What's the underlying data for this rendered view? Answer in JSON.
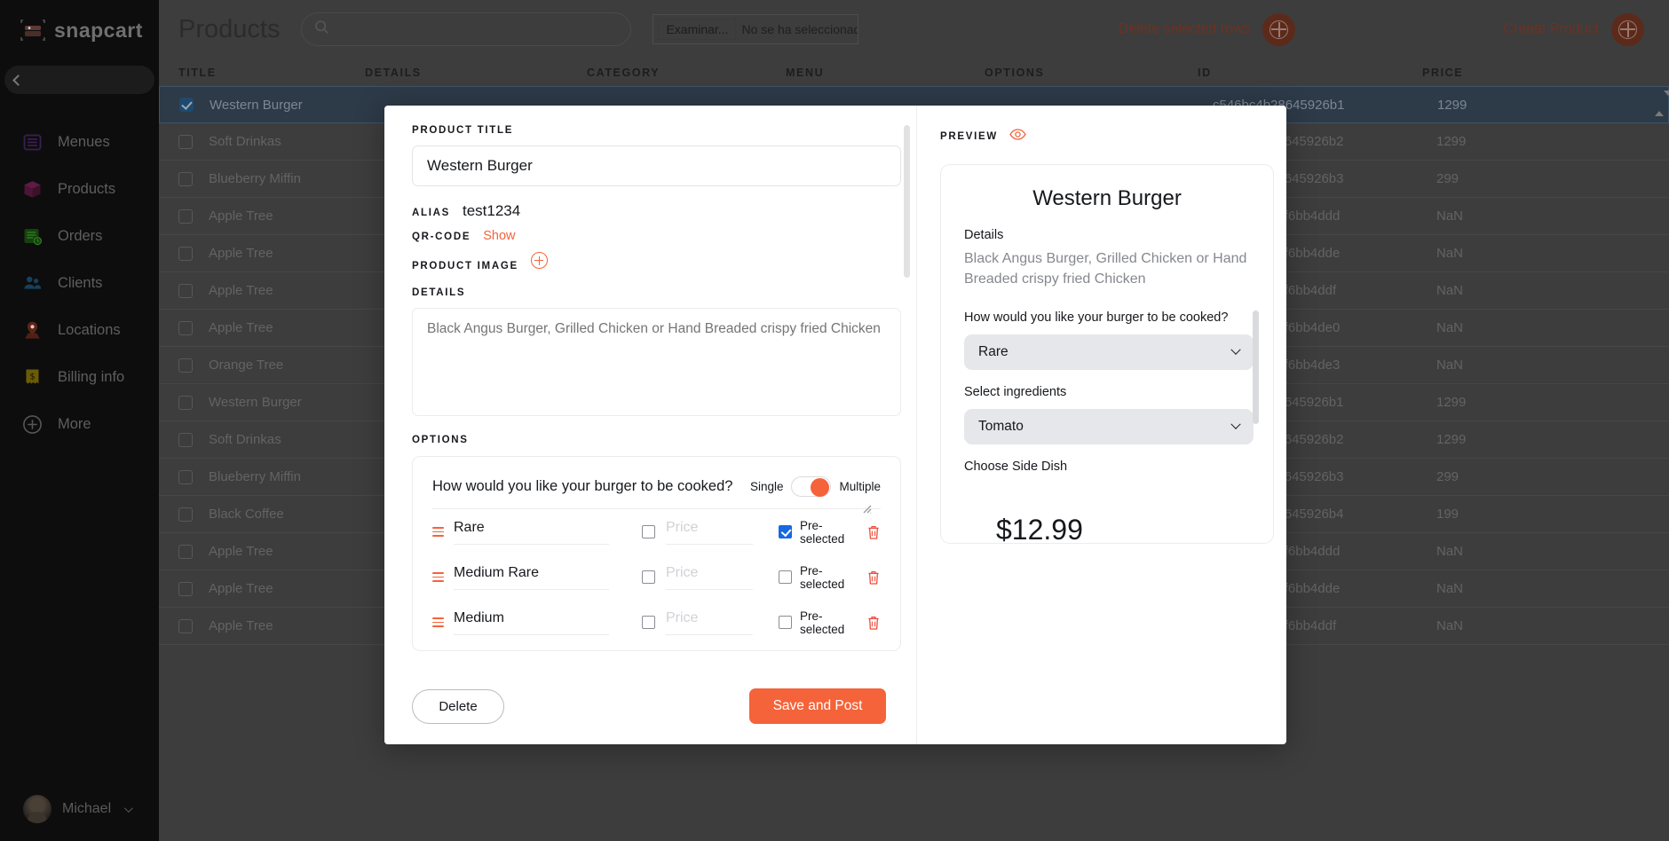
{
  "sidebar": {
    "brand": "snapcart",
    "collapse_icon": "chevron-left-icon",
    "items": [
      {
        "label": "Menues",
        "icon": "menu-list-icon"
      },
      {
        "label": "Products",
        "icon": "box-icon"
      },
      {
        "label": "Orders",
        "icon": "order-clock-icon"
      },
      {
        "label": "Clients",
        "icon": "users-icon"
      },
      {
        "label": "Locations",
        "icon": "map-pin-icon"
      },
      {
        "label": "Billing info",
        "icon": "receipt-dollar-icon"
      },
      {
        "label": "More",
        "icon": "plus-circle-icon"
      }
    ],
    "user": {
      "name": "Michael",
      "caret_icon": "chevron-down-icon",
      "avatar": "avatar"
    }
  },
  "topbar": {
    "page_title": "Products",
    "search_icon": "search-icon",
    "search_value": "",
    "search_placeholder": "",
    "file_button": "Examinar...",
    "file_status": "No se ha seleccionado ningún archivo",
    "delete_rows": "Delete selected rows",
    "create_product": "Create Product",
    "plus_icon": "plus-circle-icon"
  },
  "table": {
    "columns": [
      "TITLE",
      "DETAILS",
      "CATEGORY",
      "MENU",
      "OPTIONS",
      "ID",
      "PRICE"
    ],
    "rows": [
      {
        "title": "Western Burger",
        "id": "c546bc4b28645926b1",
        "price": "1299",
        "selected": true
      },
      {
        "title": "Soft Drinkas",
        "id": "c546bc4b28645926b2",
        "price": "1299",
        "selected": false
      },
      {
        "title": "Blueberry Miffin",
        "id": "c546bc4b28645926b3",
        "price": "299",
        "selected": false
      },
      {
        "title": "Apple Tree",
        "id": "9e1bacc44df6bb4ddd",
        "price": "NaN",
        "selected": false
      },
      {
        "title": "Apple Tree",
        "id": "9e1bacc44df6bb4dde",
        "price": "NaN",
        "selected": false
      },
      {
        "title": "Apple Tree",
        "id": "9e1bacc44df6bb4ddf",
        "price": "NaN",
        "selected": false
      },
      {
        "title": "Apple Tree",
        "id": "9e1bacc44df6bb4de0",
        "price": "NaN",
        "selected": false
      },
      {
        "title": "Orange Tree",
        "id": "9e1bacc44df6bb4de3",
        "price": "NaN",
        "selected": false
      },
      {
        "title": "Western Burger",
        "id": "c546bc4b28645926b1",
        "price": "1299",
        "selected": false
      },
      {
        "title": "Soft Drinkas",
        "id": "c546bc4b28645926b2",
        "price": "1299",
        "selected": false
      },
      {
        "title": "Blueberry Miffin",
        "id": "c546bc4b28645926b3",
        "price": "299",
        "selected": false
      },
      {
        "title": "Black Coffee",
        "id": "c546bc4b28645926b4",
        "price": "199",
        "selected": false
      },
      {
        "title": "Apple Tree",
        "id": "9e1bacc44df6bb4ddd",
        "price": "NaN",
        "selected": false
      },
      {
        "title": "Apple Tree",
        "id": "9e1bacc44df6bb4dde",
        "price": "NaN",
        "selected": false
      },
      {
        "title": "Apple Tree",
        "id": "9e1bacc44df6bb4ddf",
        "price": "NaN",
        "selected": false
      }
    ]
  },
  "modal": {
    "product_title_label": "PRODUCT TITLE",
    "product_title_value": "Western Burger",
    "alias_label": "ALIAS",
    "alias_value": "test1234",
    "qrcode_label": "QR-CODE",
    "qrcode_action": "Show",
    "product_image_label": "PRODUCT IMAGE",
    "product_image_add_icon": "add-circle-icon",
    "details_label": "DETAILS",
    "details_value": "",
    "details_placeholder": "Black Angus Burger, Grilled Chicken or Hand Breaded crispy fried Chicken",
    "options_label": "OPTIONS",
    "option_group": {
      "question": "How would you like your burger to be cooked?",
      "mode_single": "Single",
      "mode_multiple": "Multiple",
      "mode_selected": "Multiple",
      "price_placeholder": "Price",
      "preselected_label": "Pre-selected",
      "delete_icon": "trash-icon",
      "drag_icon": "drag-handle-icon",
      "items": [
        {
          "name": "Rare",
          "price": "",
          "has_price": false,
          "preselected": true
        },
        {
          "name": "Medium Rare",
          "price": "",
          "has_price": false,
          "preselected": false
        },
        {
          "name": "Medium",
          "price": "",
          "has_price": false,
          "preselected": false
        }
      ]
    },
    "delete_button": "Delete",
    "save_button": "Save and Post"
  },
  "preview": {
    "label": "PREVIEW",
    "eye_icon": "eye-icon",
    "title": "Western Burger",
    "details_label": "Details",
    "description": "Black Angus Burger, Grilled Chicken or Hand Breaded crispy fried Chicken",
    "question1": "How would you like your burger to be cooked?",
    "select1_value": "Rare",
    "question2": "Select ingredients",
    "select2_value": "Tomato",
    "question3": "Choose Side Dish",
    "price": "$12.99",
    "chevron_icon": "chevron-down-icon"
  },
  "colors": {
    "accent": "#f4633a",
    "accent_dim": "#6b3222",
    "selected_row": "#2d3a47",
    "checkbox_blue": "#1668e3",
    "sidebar_bg": "#0d0d0d",
    "main_bg": "#3d3d3d"
  }
}
